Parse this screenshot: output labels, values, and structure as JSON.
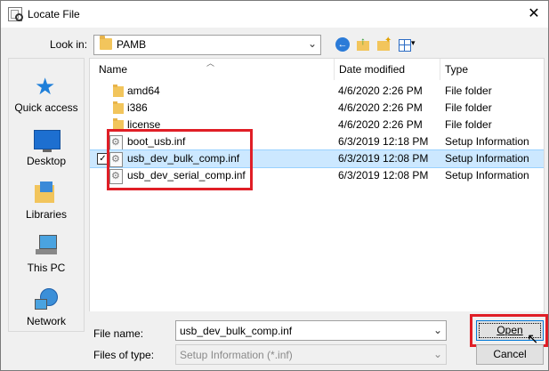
{
  "window": {
    "title": "Locate File"
  },
  "lookin": {
    "label": "Look in:",
    "value": "PAMB"
  },
  "toolbar": {
    "back_label": "←",
    "up_label": "↑",
    "new_folder_label": "✦",
    "view_menu_label": "▾"
  },
  "places": [
    {
      "label": "Quick access",
      "icon": "star-icon"
    },
    {
      "label": "Desktop",
      "icon": "desktop-icon"
    },
    {
      "label": "Libraries",
      "icon": "libraries-icon"
    },
    {
      "label": "This PC",
      "icon": "computer-icon"
    },
    {
      "label": "Network",
      "icon": "network-icon"
    }
  ],
  "filelist": {
    "columns": [
      "Name",
      "Date modified",
      "Type"
    ],
    "rows": [
      {
        "name": "amd64",
        "date": "4/6/2020 2:26 PM",
        "type": "File folder",
        "icon": "folder-icon",
        "checked": false,
        "selected": false
      },
      {
        "name": "i386",
        "date": "4/6/2020 2:26 PM",
        "type": "File folder",
        "icon": "folder-icon",
        "checked": false,
        "selected": false
      },
      {
        "name": "license",
        "date": "4/6/2020 2:26 PM",
        "type": "File folder",
        "icon": "folder-icon",
        "checked": false,
        "selected": false
      },
      {
        "name": "boot_usb.inf",
        "date": "6/3/2019 12:18 PM",
        "type": "Setup Information",
        "icon": "inf-file-icon",
        "checked": false,
        "selected": false
      },
      {
        "name": "usb_dev_bulk_comp.inf",
        "date": "6/3/2019 12:08 PM",
        "type": "Setup Information",
        "icon": "inf-file-icon",
        "checked": true,
        "selected": true
      },
      {
        "name": "usb_dev_serial_comp.inf",
        "date": "6/3/2019 12:08 PM",
        "type": "Setup Information",
        "icon": "inf-file-icon",
        "checked": false,
        "selected": false
      }
    ]
  },
  "filename": {
    "label": "File name:",
    "value": "usb_dev_bulk_comp.inf"
  },
  "filetype": {
    "label": "Files of type:",
    "value": "Setup Information (*.inf)"
  },
  "buttons": {
    "open": "Open",
    "cancel": "Cancel"
  },
  "colors": {
    "highlight_box": "#e01e26",
    "selection": "#cce8ff",
    "accent": "#0078d7"
  }
}
